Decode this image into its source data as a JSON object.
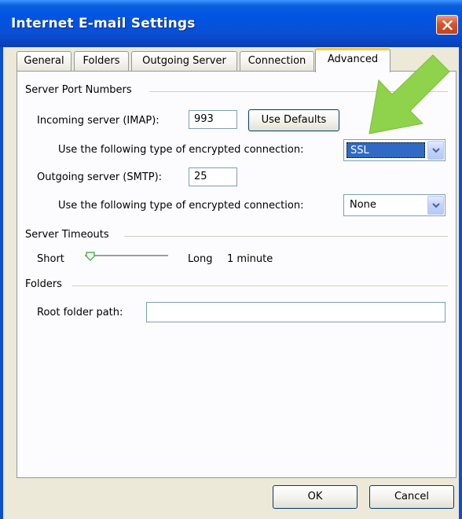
{
  "window": {
    "title": "Internet E-mail Settings",
    "close_icon": "close-icon"
  },
  "tabs": [
    {
      "label": "General",
      "active": false
    },
    {
      "label": "Folders",
      "active": false
    },
    {
      "label": "Outgoing Server",
      "active": false
    },
    {
      "label": "Connection",
      "active": false
    },
    {
      "label": "Advanced",
      "active": true
    }
  ],
  "server_ports": {
    "group_label": "Server Port Numbers",
    "incoming_label": "Incoming server (IMAP):",
    "incoming_value": "993",
    "use_defaults_label": "Use Defaults",
    "incoming_enc_label": "Use the following type of encrypted connection:",
    "incoming_enc_value": "SSL",
    "outgoing_label": "Outgoing server (SMTP):",
    "outgoing_value": "25",
    "outgoing_enc_label": "Use the following type of encrypted connection:",
    "outgoing_enc_value": "None"
  },
  "timeouts": {
    "group_label": "Server Timeouts",
    "short_label": "Short",
    "long_label": "Long",
    "value_label": "1 minute",
    "slider_level": 0.0
  },
  "folders": {
    "group_label": "Folders",
    "root_label": "Root folder path:",
    "root_value": ""
  },
  "footer": {
    "ok_label": "OK",
    "cancel_label": "Cancel"
  },
  "colors": {
    "titlebar": "#0054e3",
    "active_tab_accent": "#ffc83c",
    "selection": "#316ac5",
    "annotation_arrow": "#8fd24b"
  }
}
